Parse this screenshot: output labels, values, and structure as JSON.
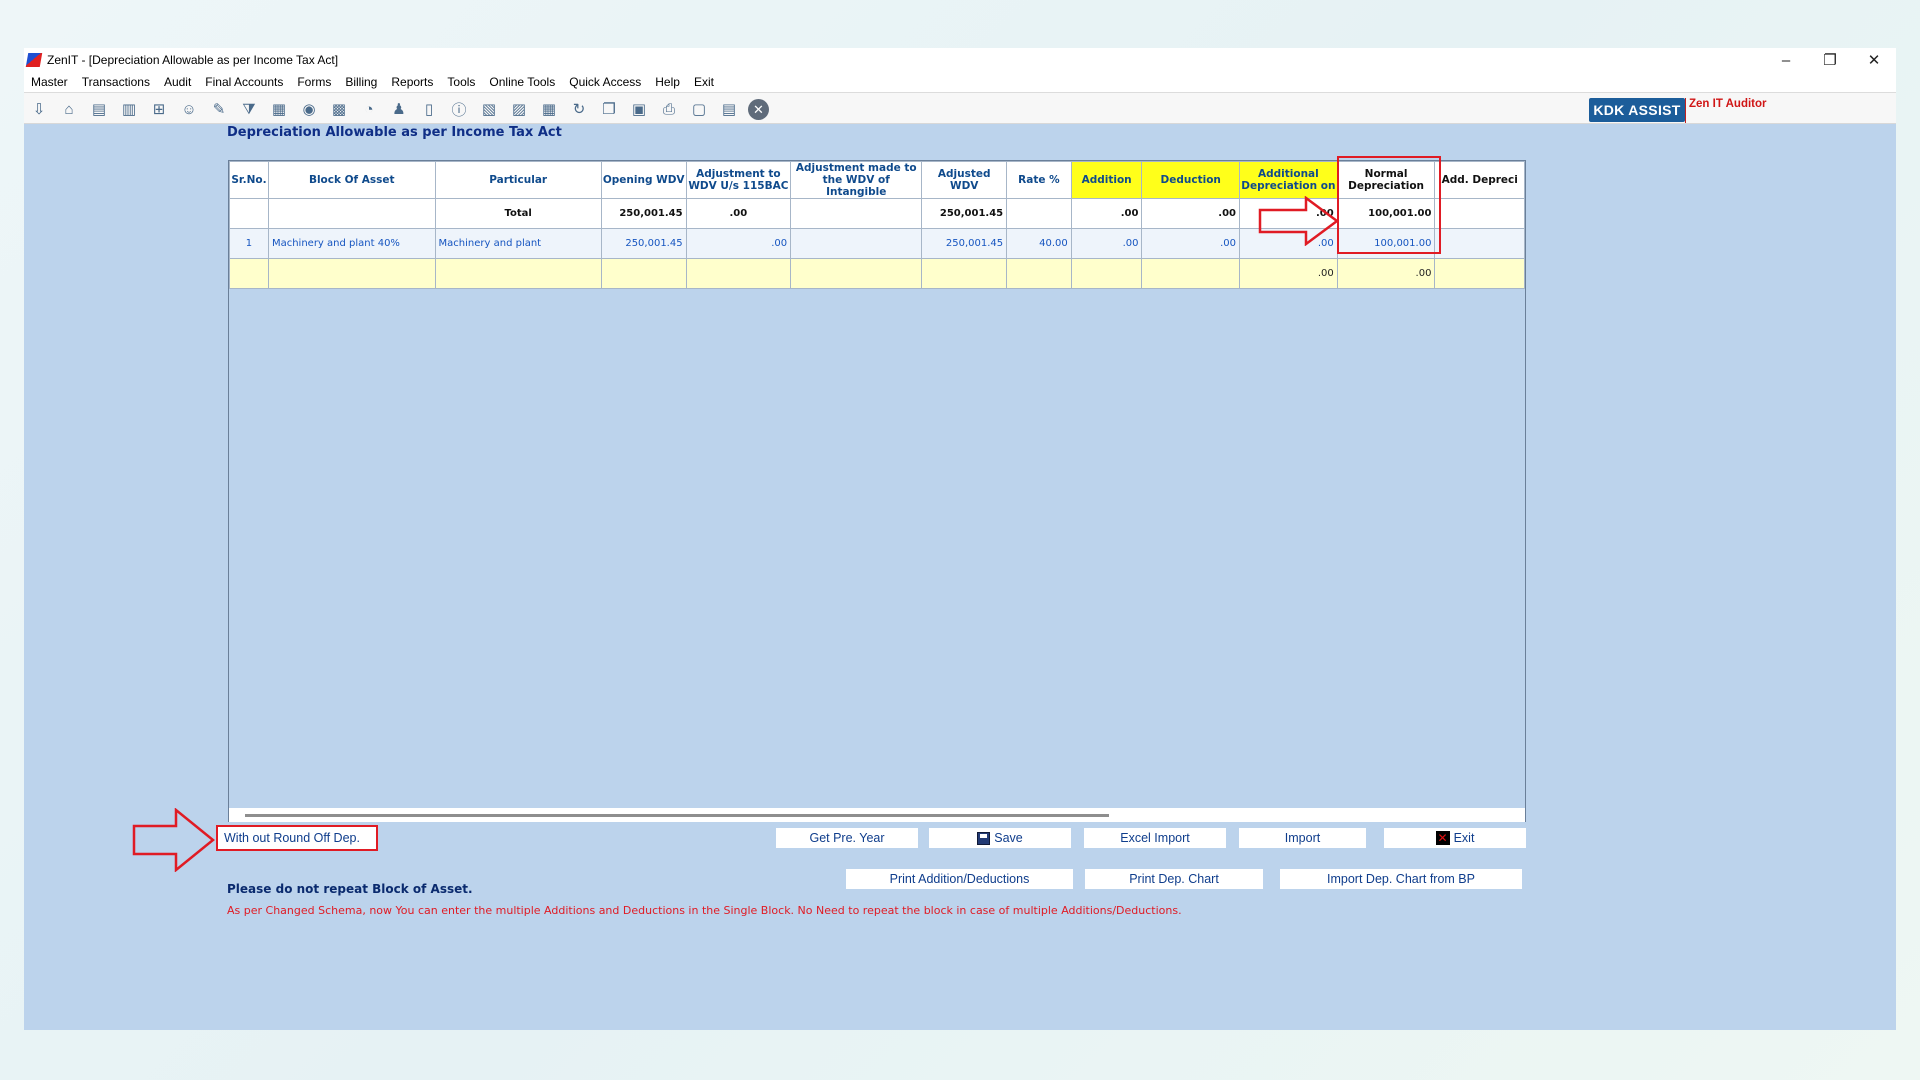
{
  "window": {
    "title": "ZenIT - [Depreciation Allowable as per Income Tax Act]",
    "controls": {
      "minimize": "–",
      "restore": "❐",
      "close": "✕"
    }
  },
  "menu": [
    "Master",
    "Transactions",
    "Audit",
    "Final Accounts",
    "Forms",
    "Billing",
    "Reports",
    "Tools",
    "Online Tools",
    "Quick Access",
    "Help",
    "Exit"
  ],
  "toolbar": {
    "icons": [
      "import-icon",
      "home-icon",
      "ledger-icon",
      "bar-chart-icon",
      "gift-icon",
      "group-icon",
      "pen-icon",
      "filter-icon",
      "tax-icon",
      "coins-icon",
      "calculator-icon",
      "pie-chart-icon",
      "pay-icon",
      "book-icon",
      "info-icon",
      "report-icon",
      "notes-icon",
      "calendar-icon",
      "refresh-icon",
      "copy-icon",
      "bs-icon",
      "print-icon",
      "sco-icon",
      "document-icon",
      "close-circle-icon"
    ],
    "kdk_label": "KDK ASSIST",
    "zen_auditor": "Zen IT Auditor"
  },
  "page": {
    "title": "Depreciation Allowable as per Income Tax Act"
  },
  "table": {
    "headers": [
      "Sr.No.",
      "Block Of Asset",
      "Particular",
      "Opening WDV",
      "Adjustment to WDV U/s 115BAC",
      "Adjustment made to the WDV of Intangible",
      "Adjusted WDV",
      "Rate %",
      "Addition",
      "Deduction",
      "Additional Depreciation on",
      "Normal Depreciation",
      "Add. Depreci"
    ],
    "total": [
      "",
      "",
      "Total",
      "250,001.45",
      ".00",
      "",
      "250,001.45",
      "",
      ".00",
      ".00",
      ".00",
      "100,001.00",
      ""
    ],
    "rows": [
      [
        "1",
        "Machinery and plant 40%",
        "Machinery and plant",
        "250,001.45",
        ".00",
        "",
        "250,001.45",
        "40.00",
        ".00",
        ".00",
        ".00",
        "100,001.00",
        ""
      ]
    ],
    "blank_row": [
      "",
      "",
      "",
      "",
      "",
      "",
      "",
      "",
      "",
      "",
      ".00",
      ".00",
      ""
    ]
  },
  "buttons": {
    "round_off": "With out Round Off Dep.",
    "get_pre_year": "Get Pre. Year",
    "save": "Save",
    "excel_import": "Excel Import",
    "import": "Import",
    "exit": "Exit",
    "print_addition": "Print Addition/Deductions",
    "print_dep_chart": "Print Dep. Chart",
    "import_dep_chart": "Import Dep. Chart from BP"
  },
  "messages": {
    "warning": "Please do not repeat Block of Asset.",
    "schema": "As per Changed Schema, now You can enter the multiple Additions and Deductions in the Single Block. No Need to repeat the block in case of multiple Additions/Deductions."
  },
  "colors": {
    "accent_red": "#e01b24",
    "header_yellow": "#ffff1a",
    "window_blue": "#bcd3ec",
    "kdk_blue": "#1c5d9a"
  }
}
